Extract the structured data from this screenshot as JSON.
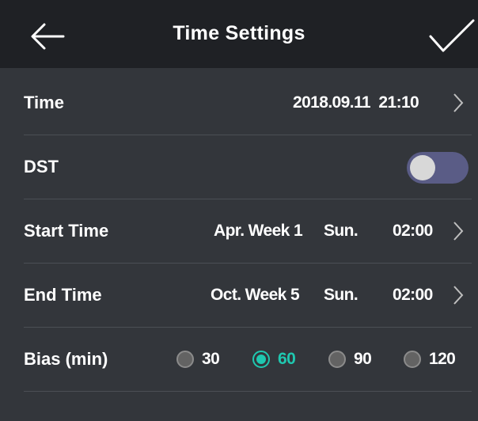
{
  "header": {
    "title": "Time Settings",
    "back_icon": "arrow-left-icon",
    "confirm_icon": "checkmark-icon"
  },
  "rows": {
    "time": {
      "label": "Time",
      "value": "2018.09.11  21:10"
    },
    "dst": {
      "label": "DST",
      "enabled": false
    },
    "start_time": {
      "label": "Start Time",
      "month_week": "Apr. Week 1",
      "day": "Sun.",
      "time": "02:00"
    },
    "end_time": {
      "label": "End Time",
      "month_week": "Oct. Week 5",
      "day": "Sun.",
      "time": "02:00"
    },
    "bias": {
      "label": "Bias (min)",
      "options": [
        "30",
        "60",
        "90",
        "120"
      ],
      "selected": "60"
    }
  },
  "colors": {
    "accent": "#1fc8b0",
    "toggle_track": "#5a5c86",
    "background": "#33363b",
    "header": "#1f2125"
  }
}
